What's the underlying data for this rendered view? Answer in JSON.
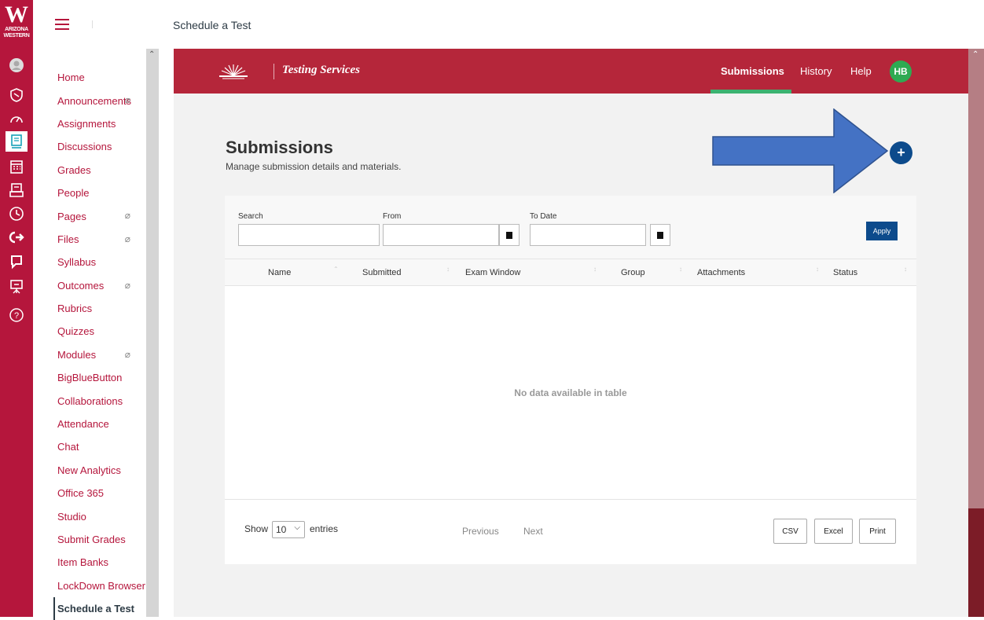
{
  "header": {
    "breadcrumb": "Schedule a Test"
  },
  "global_nav": {
    "logo_text": "ARIZONA WESTERN",
    "logo_letter": "W",
    "icons": [
      "account-icon",
      "admin-icon",
      "dashboard-icon",
      "courses-icon",
      "calendar-icon",
      "inbox-icon",
      "history-icon",
      "commons-icon",
      "studio-icon",
      "ti-icon",
      "help-icon"
    ]
  },
  "course_nav": {
    "items": [
      {
        "label": "Home",
        "hidden": false
      },
      {
        "label": "Announcements",
        "hidden": true
      },
      {
        "label": "Assignments",
        "hidden": false
      },
      {
        "label": "Discussions",
        "hidden": false
      },
      {
        "label": "Grades",
        "hidden": false
      },
      {
        "label": "People",
        "hidden": false
      },
      {
        "label": "Pages",
        "hidden": true
      },
      {
        "label": "Files",
        "hidden": true
      },
      {
        "label": "Syllabus",
        "hidden": false
      },
      {
        "label": "Outcomes",
        "hidden": true
      },
      {
        "label": "Rubrics",
        "hidden": false
      },
      {
        "label": "Quizzes",
        "hidden": false
      },
      {
        "label": "Modules",
        "hidden": true
      },
      {
        "label": "BigBlueButton",
        "hidden": false
      },
      {
        "label": "Collaborations",
        "hidden": false
      },
      {
        "label": "Attendance",
        "hidden": false
      },
      {
        "label": "Chat",
        "hidden": false
      },
      {
        "label": "New Analytics",
        "hidden": false
      },
      {
        "label": "Office 365",
        "hidden": false
      },
      {
        "label": "Studio",
        "hidden": false
      },
      {
        "label": "Submit Grades",
        "hidden": false
      },
      {
        "label": "Item Banks",
        "hidden": false
      },
      {
        "label": "LockDown Browser",
        "hidden": false
      },
      {
        "label": "Schedule a Test",
        "hidden": false,
        "active": true
      }
    ]
  },
  "app": {
    "brand": "Testing Services",
    "nav": {
      "submissions": "Submissions",
      "history": "History",
      "help": "Help"
    },
    "avatar": "HB",
    "accent_color": "#b5263a"
  },
  "page": {
    "title": "Submissions",
    "subtitle": "Manage submission details and materials.",
    "add_icon": "+"
  },
  "filters": {
    "search_label": "Search",
    "from_label": "From",
    "to_label": "To Date",
    "apply": "Apply"
  },
  "table": {
    "columns": [
      "Name",
      "Submitted",
      "Exam Window",
      "Group",
      "Attachments",
      "Status"
    ],
    "empty": "No data available in table"
  },
  "footer": {
    "show": "Show",
    "page_length": "10",
    "entries": "entries",
    "previous": "Previous",
    "next": "Next",
    "csv": "CSV",
    "excel": "Excel",
    "print": "Print"
  }
}
